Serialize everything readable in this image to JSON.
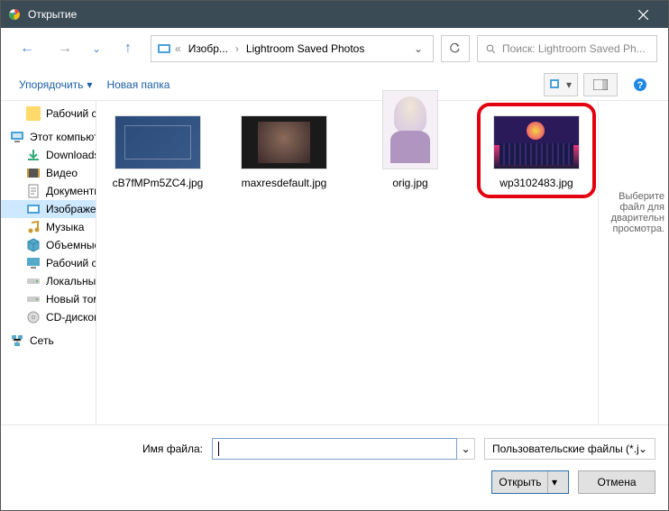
{
  "window": {
    "title": "Открытие"
  },
  "nav": {
    "breadcrumb_parent": "Изобр...",
    "breadcrumb_current": "Lightroom Saved Photos",
    "search_placeholder": "Поиск: Lightroom Saved Ph..."
  },
  "toolbar": {
    "organize": "Упорядочить",
    "new_folder": "Новая папка"
  },
  "tree": {
    "desktop": "Рабочий стол",
    "this_pc": "Этот компьютер",
    "downloads": "Downloads",
    "videos": "Видео",
    "documents": "Документы",
    "pictures": "Изображения",
    "music": "Музыка",
    "objects3d": "Объемные объ",
    "desktop2": "Рабочий стол",
    "local_c": "Локальный дис",
    "new_vol_d": "Новый том (D:)",
    "cd_drive": "CD-дисковод (F:",
    "network": "Сеть"
  },
  "files": [
    {
      "name": "cB7fMPm5ZC4.jpg"
    },
    {
      "name": "maxresdefault.jpg"
    },
    {
      "name": "orig.jpg"
    },
    {
      "name": "wp3102483.jpg"
    }
  ],
  "preview": {
    "line1": "Выберите",
    "line2": "файл для",
    "line3": "дварительн",
    "line4": "просмотра."
  },
  "bottom": {
    "filename_label": "Имя файла:",
    "filename_value": "",
    "filter": "Пользовательские файлы (*.jf",
    "open": "Открыть",
    "cancel": "Отмена"
  }
}
